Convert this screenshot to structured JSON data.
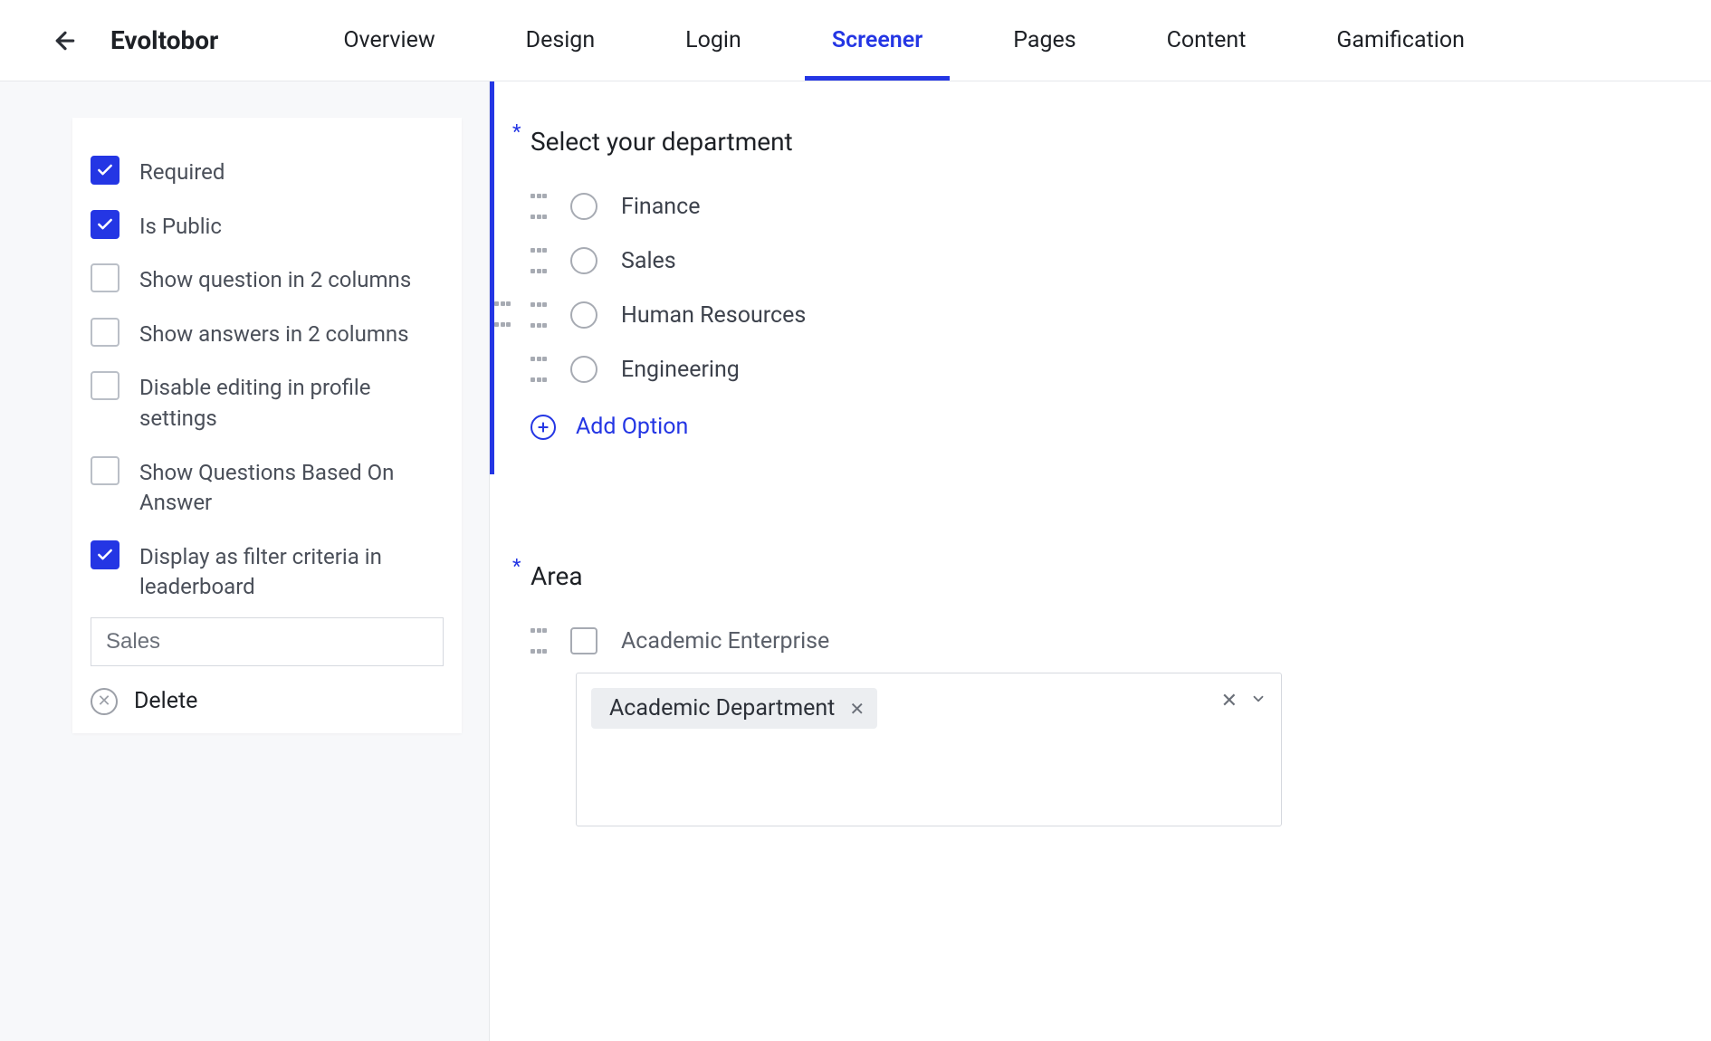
{
  "header": {
    "title": "Evoltobor",
    "tabs": [
      {
        "label": "Overview",
        "active": false
      },
      {
        "label": "Design",
        "active": false
      },
      {
        "label": "Login",
        "active": false
      },
      {
        "label": "Screener",
        "active": true
      },
      {
        "label": "Pages",
        "active": false
      },
      {
        "label": "Content",
        "active": false
      },
      {
        "label": "Gamification",
        "active": false
      }
    ]
  },
  "sidebar": {
    "options": [
      {
        "label": "Required",
        "checked": true
      },
      {
        "label": "Is Public",
        "checked": true
      },
      {
        "label": "Show question in 2 columns",
        "checked": false
      },
      {
        "label": "Show answers in 2 columns",
        "checked": false
      },
      {
        "label": "Disable editing in profile settings",
        "checked": false
      },
      {
        "label": "Show Questions Based On Answer",
        "checked": false
      },
      {
        "label": "Display as filter criteria in leaderboard",
        "checked": true
      }
    ],
    "filter_value": "Sales",
    "delete_label": "Delete"
  },
  "main": {
    "question1": {
      "title": "Select your department",
      "options": [
        {
          "label": "Finance"
        },
        {
          "label": "Sales"
        },
        {
          "label": "Human Resources"
        },
        {
          "label": "Engineering"
        }
      ],
      "add_label": "Add Option"
    },
    "question2": {
      "title": "Area",
      "row_label": "Academic Enterprise",
      "tags": [
        {
          "label": "Academic Department"
        }
      ]
    }
  }
}
